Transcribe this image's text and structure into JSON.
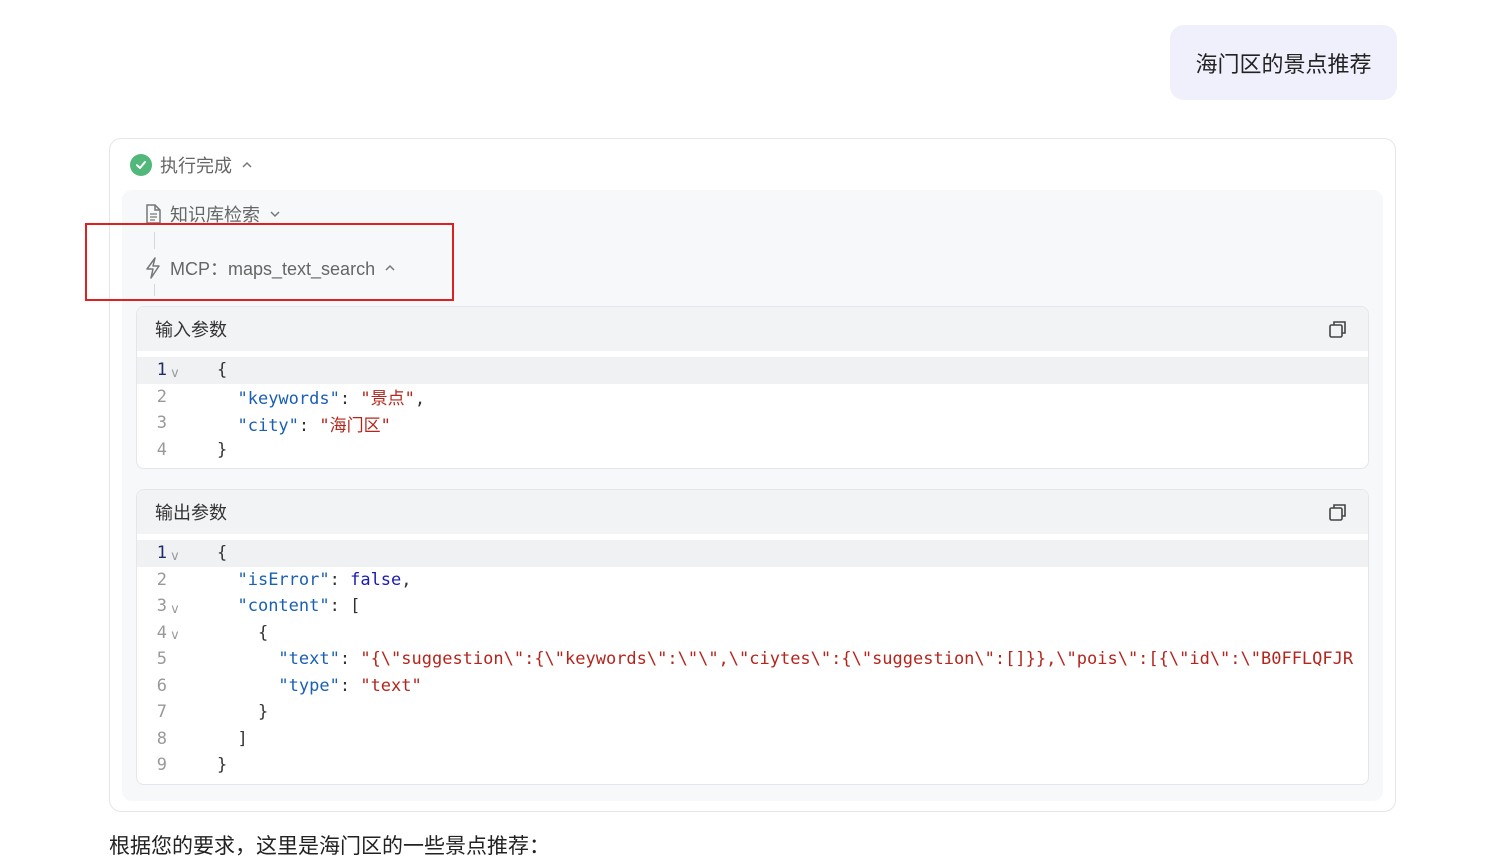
{
  "user_message": "海门区的景点推荐",
  "execution": {
    "status_label": "执行完成",
    "steps": {
      "knowledge_label": "知识库检索",
      "mcp_label": "MCP：maps_text_search"
    },
    "input": {
      "title": "输入参数",
      "lines": [
        {
          "n": "1",
          "fold": "v",
          "active": true,
          "html": "{"
        },
        {
          "n": "2",
          "fold": "",
          "html": "  <span class=\"k\">\"keywords\"</span>: <span class=\"s\">\"景点\"</span>,"
        },
        {
          "n": "3",
          "fold": "",
          "html": "  <span class=\"k\">\"city\"</span>: <span class=\"s\">\"海门区\"</span>"
        },
        {
          "n": "4",
          "fold": "",
          "html": "}"
        }
      ]
    },
    "output": {
      "title": "输出参数",
      "lines": [
        {
          "n": "1",
          "fold": "v",
          "active": true,
          "html": "{"
        },
        {
          "n": "2",
          "fold": "",
          "html": "  <span class=\"k\">\"isError\"</span>: <span class=\"b\">false</span>,"
        },
        {
          "n": "3",
          "fold": "v",
          "html": "  <span class=\"k\">\"content\"</span>: ["
        },
        {
          "n": "4",
          "fold": "v",
          "html": "    {"
        },
        {
          "n": "5",
          "fold": "",
          "html": "      <span class=\"k\">\"text\"</span>: <span class=\"s\">\"{\\\"suggestion\\\":{\\\"keywords\\\":\\\"\\\",\\\"ciytes\\\":{\\\"suggestion\\\":[]}},\\\"pois\\\":[{\\\"id\\\":\\\"B0FFLQFJR</span>"
        },
        {
          "n": "6",
          "fold": "",
          "html": "      <span class=\"k\">\"type\"</span>: <span class=\"s\">\"text\"</span>"
        },
        {
          "n": "7",
          "fold": "",
          "html": "    }"
        },
        {
          "n": "8",
          "fold": "",
          "html": "  ]"
        },
        {
          "n": "9",
          "fold": "",
          "html": "}"
        }
      ]
    }
  },
  "answer_text": "根据您的要求，这里是海门区的一些景点推荐：",
  "colors": {
    "success": "#52b77a",
    "highlight": "#e02020",
    "bubble": "#f0effc"
  }
}
